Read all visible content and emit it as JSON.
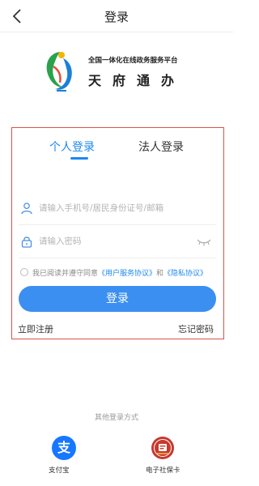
{
  "header": {
    "title": "登录"
  },
  "brand": {
    "line1": "全国一体化在线政务服务平台",
    "line2": "天府通办"
  },
  "tabs": [
    {
      "label": "个人登录"
    },
    {
      "label": "法人登录"
    }
  ],
  "form": {
    "account_placeholder": "请输入手机号/居民身份证号/邮箱",
    "password_placeholder": "请输入密码",
    "agreement_prefix": "我已阅读并遵守同意",
    "user_agreement": "《用户服务协议》",
    "agreement_and": "和",
    "privacy_agreement": "《隐私协议》",
    "login_label": "登录",
    "register_label": "立即注册",
    "forgot_label": "忘记密码"
  },
  "other_login": {
    "title": "其他登录方式",
    "alipay_icon_glyph": "支",
    "alipay_label": "支付宝",
    "social_card_label": "电子社保卡"
  },
  "colors": {
    "accent": "#1c88f0",
    "button": "#3b8ff0",
    "highlight_border": "#d9534f",
    "alipay": "#1677ff",
    "social_card": "#c7382f"
  }
}
